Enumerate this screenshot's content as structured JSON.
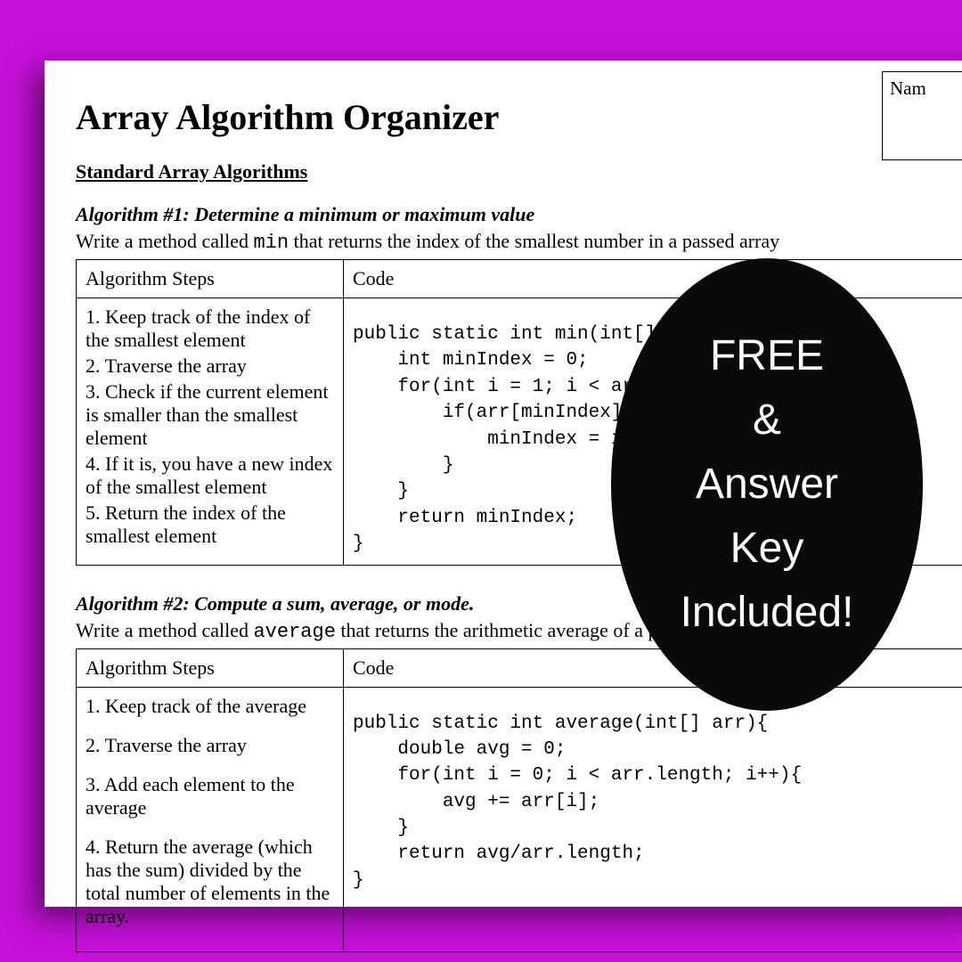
{
  "document": {
    "title": "Array Algorithm Organizer",
    "name_label": "Nam",
    "section_heading": "Standard Array Algorithms",
    "table_headers": {
      "steps": "Algorithm Steps",
      "code": "Code"
    },
    "algo1": {
      "title": "Algorithm #1: Determine a minimum or maximum value",
      "desc_pre": "Write a method called ",
      "desc_mono": "min",
      "desc_post": " that returns the index of the smallest number in a passed array",
      "steps": {
        "s1": "1. Keep track of the index of the smallest element",
        "s2": "2. Traverse the array",
        "s3": "3. Check if the current element is smaller than the smallest element",
        "s4": "4. If it is, you have a new index of the smallest element",
        "s5": "5. Return the index of the smallest element"
      },
      "code": "public static int min(int[]\n    int minIndex = 0;\n    for(int i = 1; i < arr\n        if(arr[minIndex]\n            minIndex = i\n        }\n    }\n    return minIndex;\n}"
    },
    "algo2": {
      "title": "Algorithm #2: Compute a sum, average, or mode.",
      "desc_pre": "Write a method called ",
      "desc_mono": "average",
      "desc_post": " that returns the arithmetic average of a passed",
      "steps": {
        "s1": "1. Keep track of the average",
        "s2": "2. Traverse the array",
        "s3": "3. Add each element to the average",
        "s4": "4. Return the average (which has the sum) divided by the total number of elements in the array."
      },
      "code": "public static int average(int[] arr){\n    double avg = 0;\n    for(int i = 0; i < arr.length; i++){\n        avg += arr[i];\n    }\n    return avg/arr.length;\n}"
    }
  },
  "badge": {
    "line1": "FREE",
    "line2": "&",
    "line3": "Answer",
    "line4": "Key",
    "line5": "Included!"
  }
}
